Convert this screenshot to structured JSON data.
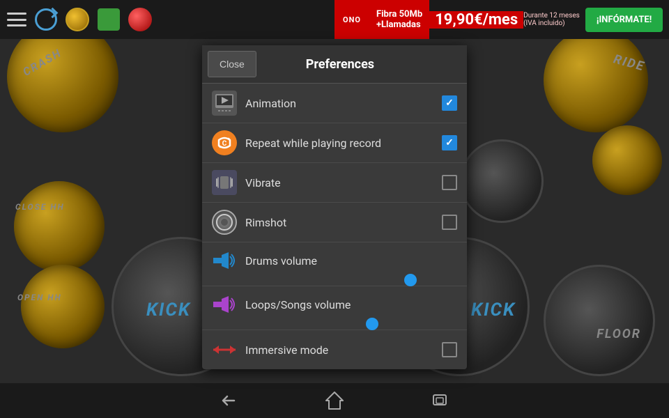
{
  "topbar": {
    "icons": [
      "menu",
      "refresh",
      "gold-circle",
      "green-square",
      "red-circle"
    ]
  },
  "ad": {
    "brand": "ONO",
    "line1": "Fibra 50Mb",
    "line2": "+Llamadas",
    "price": "19,90€/mes",
    "sub1": "Durante 12 meses",
    "sub2": "(IVA incluido)",
    "button": "¡INFÓRMATE!"
  },
  "dialog": {
    "title": "Preferences",
    "close_label": "Close",
    "items": [
      {
        "id": "animation",
        "label": "Animation",
        "checked": true,
        "has_checkbox": true
      },
      {
        "id": "repeat",
        "label": "Repeat while playing record",
        "checked": true,
        "has_checkbox": true
      },
      {
        "id": "vibrate",
        "label": "Vibrate",
        "checked": false,
        "has_checkbox": true
      },
      {
        "id": "rimshot",
        "label": "Rimshot",
        "checked": false,
        "has_checkbox": true
      },
      {
        "id": "drums_volume",
        "label": "Drums volume",
        "is_slider": true,
        "value": 78
      },
      {
        "id": "loops_volume",
        "label": "Loops/Songs volume",
        "is_slider": true,
        "value": 60
      },
      {
        "id": "immersive",
        "label": "Immersive mode",
        "checked": false,
        "has_checkbox": true
      }
    ]
  },
  "drums": {
    "crash_label": "CRASH",
    "ride_label": "RIDE",
    "closehh_label": "CLOSE HH",
    "openhh_label": "OPEN HH",
    "floor_label": "FLOOR",
    "kick1_label": "KICK",
    "kick2_label": "KICK"
  }
}
